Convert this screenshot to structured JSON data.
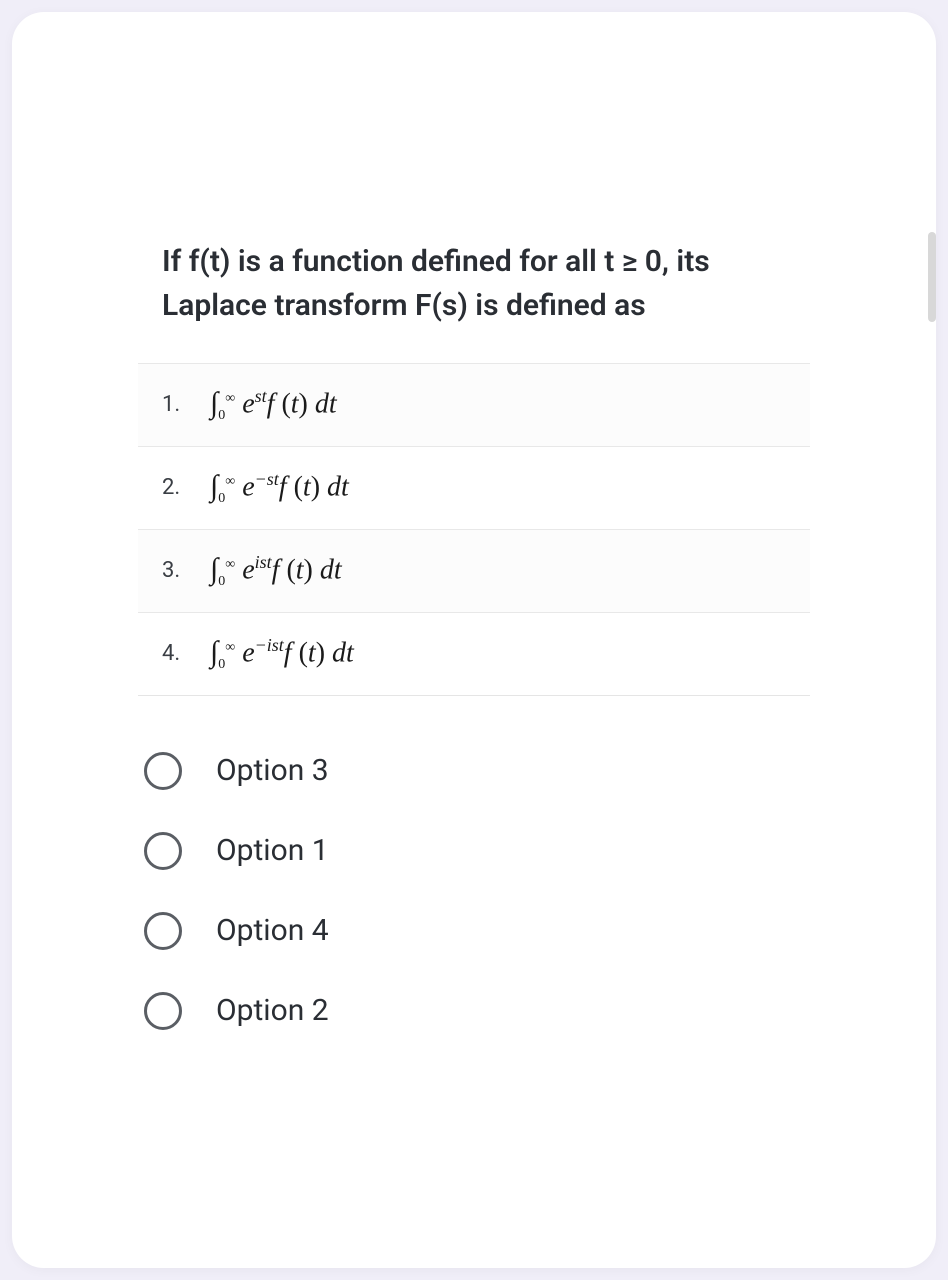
{
  "question": {
    "text": "If f(t) is a function defined for all t ≥ 0, its Laplace transform F(s) is defined as",
    "items": [
      {
        "number": "1.",
        "exponent": "st"
      },
      {
        "number": "2.",
        "exponent": "−st"
      },
      {
        "number": "3.",
        "exponent": "ist"
      },
      {
        "number": "4.",
        "exponent": "−ist"
      }
    ]
  },
  "answers": [
    {
      "label": "Option 3"
    },
    {
      "label": "Option 1"
    },
    {
      "label": "Option 4"
    },
    {
      "label": "Option 2"
    }
  ]
}
